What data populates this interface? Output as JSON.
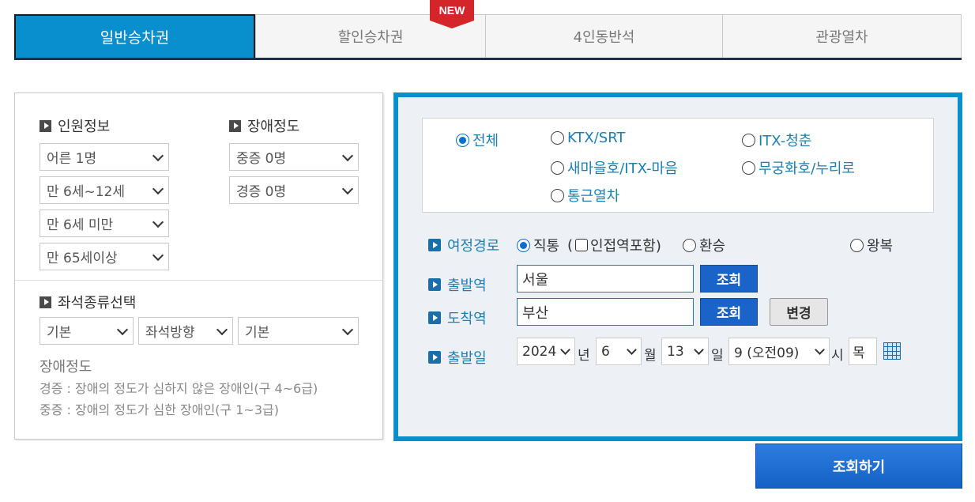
{
  "tabs": [
    {
      "label": "일반승차권"
    },
    {
      "label": "할인승차권"
    },
    {
      "label": "4인동반석"
    },
    {
      "label": "관광열차"
    }
  ],
  "new_badge": "NEW",
  "left": {
    "passenger_title": "인원정보",
    "disability_title": "장애정도",
    "passenger_selects": [
      "어른 1명",
      "만 6세~12세",
      "만 6세 미만",
      "만 65세이상"
    ],
    "disability_selects": [
      "중증 0명",
      "경증 0명"
    ],
    "seat_title": "좌석종류선택",
    "seat_selects": [
      "기본",
      "좌석방향",
      "기본"
    ],
    "note_title": "장애정도",
    "notes": [
      "경증 : 장애의 정도가 심하지 않은 장애인(구 4~6급)",
      "중증 : 장애의 정도가 심한 장애인(구 1~3급)"
    ]
  },
  "train_types": [
    {
      "label": "전체",
      "selected": true
    },
    {
      "label": "KTX/SRT",
      "selected": false
    },
    {
      "label": "ITX-청춘",
      "selected": false
    },
    {
      "label": "새마을호/ITX-마음",
      "selected": false
    },
    {
      "label": "무궁화호/누리로",
      "selected": false
    },
    {
      "label": "통근열차",
      "selected": false
    }
  ],
  "route": {
    "label": "여정경로",
    "direct": "직통",
    "adjacent_open": "(",
    "adjacent": "인접역포함)",
    "transfer": "환승",
    "roundtrip": "왕복"
  },
  "departure": {
    "label": "출발역",
    "value": "서울",
    "search": "조회"
  },
  "arrival": {
    "label": "도착역",
    "value": "부산",
    "search": "조회",
    "swap": "변경"
  },
  "date": {
    "label": "출발일",
    "year": "2024",
    "year_unit": "년",
    "month": "6",
    "month_unit": "월",
    "day": "13",
    "day_unit": "일",
    "hour": "9 (오전09)",
    "hour_unit": "시",
    "weekday": "목"
  },
  "search_button": "조회하기",
  "colors": {
    "accent": "#0a8fce",
    "button": "#1a63c9",
    "badge": "#d4262a"
  }
}
